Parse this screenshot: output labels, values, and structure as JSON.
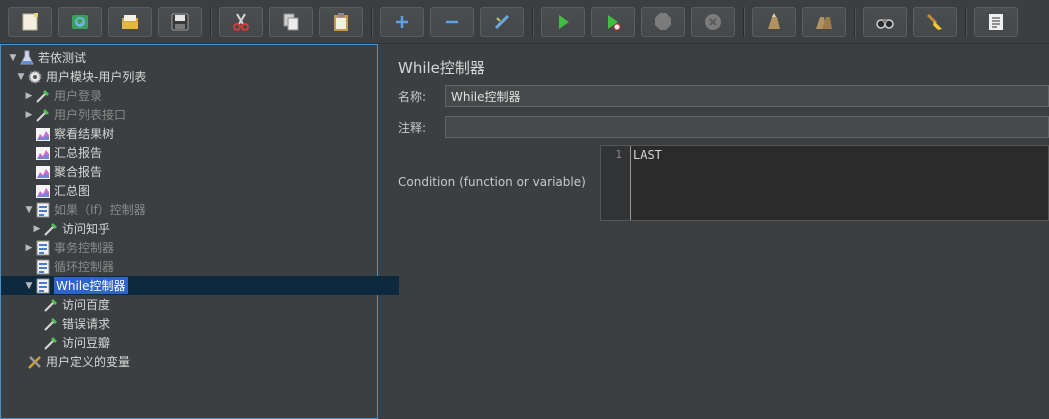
{
  "toolbar": {
    "buttons": [
      {
        "name": "new-icon"
      },
      {
        "name": "templates-icon"
      },
      {
        "name": "open-icon"
      },
      {
        "name": "save-icon"
      },
      {
        "name": "cut-icon"
      },
      {
        "name": "copy-icon"
      },
      {
        "name": "paste-icon"
      },
      {
        "name": "expand-icon"
      },
      {
        "name": "collapse-icon"
      },
      {
        "name": "toggle-icon"
      },
      {
        "name": "start-icon"
      },
      {
        "name": "start-no-pause-icon"
      },
      {
        "name": "stop-icon"
      },
      {
        "name": "shutdown-icon"
      },
      {
        "name": "clear-icon"
      },
      {
        "name": "clear-all-icon"
      },
      {
        "name": "search-icon"
      },
      {
        "name": "reset-search-icon"
      },
      {
        "name": "function-helper-icon"
      }
    ]
  },
  "tree": {
    "items": [
      {
        "label": "若依测试",
        "icon": "testplan-icon",
        "expanded": true,
        "level": 0,
        "disabled": false
      },
      {
        "label": "用户模块-用户列表",
        "icon": "threadgroup-icon",
        "expanded": true,
        "level": 1,
        "disabled": false
      },
      {
        "label": "用户登录",
        "icon": "sampler-icon",
        "expanded": false,
        "level": 2,
        "disabled": true
      },
      {
        "label": "用户列表接口",
        "icon": "sampler-icon",
        "expanded": false,
        "level": 2,
        "disabled": true
      },
      {
        "label": "察看结果树",
        "icon": "listener-icon",
        "level": 2,
        "disabled": false
      },
      {
        "label": "汇总报告",
        "icon": "listener-icon",
        "level": 2,
        "disabled": false
      },
      {
        "label": "聚合报告",
        "icon": "listener-icon",
        "level": 2,
        "disabled": false
      },
      {
        "label": "汇总图",
        "icon": "listener-icon",
        "level": 2,
        "disabled": false
      },
      {
        "label": "如果（If）控制器",
        "icon": "controller-icon",
        "expanded": true,
        "level": 2,
        "disabled": true
      },
      {
        "label": "访问知乎",
        "icon": "sampler-icon",
        "expanded": false,
        "level": 3,
        "disabled": false
      },
      {
        "label": "事务控制器",
        "icon": "controller-icon",
        "expanded": false,
        "level": 2,
        "disabled": true
      },
      {
        "label": "循环控制器",
        "icon": "controller-icon",
        "level": 2,
        "disabled": true
      },
      {
        "label": "While控制器",
        "icon": "controller-icon",
        "expanded": true,
        "level": 2,
        "disabled": false,
        "selected": true
      },
      {
        "label": "访问百度",
        "icon": "sampler-icon",
        "level": 3,
        "disabled": false
      },
      {
        "label": "错误请求",
        "icon": "sampler-icon",
        "level": 3,
        "disabled": false
      },
      {
        "label": "访问豆瓣",
        "icon": "sampler-icon",
        "level": 3,
        "disabled": false
      },
      {
        "label": "用户定义的变量",
        "icon": "config-icon",
        "level": 1,
        "disabled": false
      }
    ]
  },
  "panel": {
    "title": "While控制器",
    "name_label": "名称:",
    "name_value": "While控制器",
    "comment_label": "注释:",
    "comment_value": "",
    "condition_label": "Condition (function or variable)",
    "condition_line_number": "1",
    "condition_value": "LAST"
  }
}
